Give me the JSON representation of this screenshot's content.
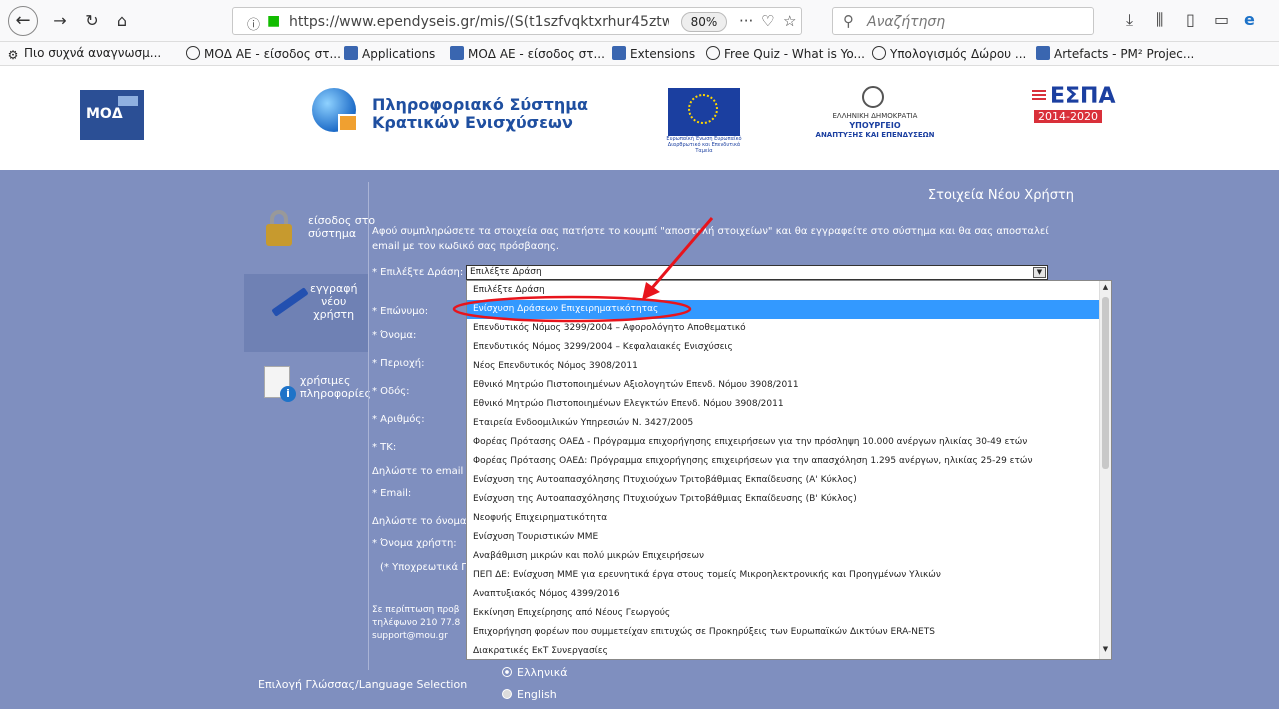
{
  "browser": {
    "url": "https://www.ependyseis.gr/mis/(S(t1szfvqktxrhur45ztw",
    "zoom": "80%",
    "search_placeholder": "Αναζήτηση"
  },
  "bookmarks": [
    "Πιο συχνά αναγνωσμ...",
    "ΜΟΔ ΑΕ - είσοδος στ...",
    "Applications",
    "ΜΟΔ ΑΕ - είσοδος στ...",
    "Extensions",
    "Free Quiz - What is Yo...",
    "Υπολογισμός Δώρου ...",
    "Artefacts - PM² Projec..."
  ],
  "banner": {
    "moda_logo": "ΜΟΔ",
    "pskt_line1": "Πληροφοριακό Σύστημα",
    "pskt_line2": "Κρατικών Ενισχύσεων",
    "eu_text": "Ευρωπαϊκή Ένωση Ευρωπαϊκό Διαρθρωτικό και Επενδυτικά Ταμεία",
    "gr_line1": "ΕΛΛΗΝΙΚΗ ΔΗΜΟΚΡΑΤΙΑ",
    "gr_line2": "ΥΠΟΥΡΓΕΙΟ",
    "gr_line3": "ΑΝΑΠΤΥΞΗΣ ΚΑΙ ΕΠΕΝΔΥΣΕΩΝ",
    "espa_title": "ΕΣΠΑ",
    "espa_years": "2014-2020"
  },
  "nav": {
    "login_line1": "είσοδος στο",
    "login_line2": "σύστημα",
    "register_line1": "εγγραφή",
    "register_line2": "νέου",
    "register_line3": "χρήστη",
    "info_line1": "χρήσιμες",
    "info_line2": "πληροφορίες"
  },
  "form": {
    "title": "Στοιχεία Νέου Χρήστη",
    "instructions": "Αφού συμπληρώσετε τα στοιχεία σας πατήστε το κουμπί \"αποστολή στοιχείων\" και θα εγγραφείτε στο σύστημα και θα σας αποσταλεί email με τον κωδικό σας πρόσβασης.",
    "action_label": "* Επιλέξτε Δράση:",
    "action_value": "Επιλέξτε Δράση",
    "labels": [
      "* Επώνυμο:",
      "* Όνομα:",
      "* Περιοχή:",
      "* Οδός:",
      "* Αριθμός:",
      "* ΤΚ:",
      "Δηλώστε το email σ",
      "* Email:",
      "Δηλώστε το όνομα χ",
      "* Όνομα χρήστη:",
      "(* Υποχρεωτικά Πε"
    ],
    "support_line1": "Σε περίπτωση προβ",
    "support_line2": "τηλέφωνο 210 77.8",
    "support_line3": "support@mou.gr"
  },
  "dropdown_options": [
    "Επιλέξτε Δράση",
    "Ενίσχυση Δράσεων Επιχειρηματικότητας",
    "Επενδυτικός Νόμος 3299/2004 – Αφορολόγητο Αποθεματικό",
    "Επενδυτικός Νόμος 3299/2004 – Κεφαλαιακές Ενισχύσεις",
    "Νέος Επενδυτικός Νόμος 3908/2011",
    "Εθνικό Μητρώο Πιστοποιημένων Αξιολογητών Επενδ. Νόμου 3908/2011",
    "Εθνικό Μητρώο Πιστοποιημένων Ελεγκτών Επενδ. Νόμου 3908/2011",
    "Εταιρεία Ενδοομιλικών Υπηρεσιών Ν. 3427/2005",
    "Φορέας Πρότασης ΟΑΕΔ - Πρόγραμμα επιχορήγησης επιχειρήσεων για την πρόσληψη 10.000 ανέργων ηλικίας 30-49 ετών",
    "Φορέας Πρότασης ΟΑΕΔ: Πρόγραμμα επιχορήγησης επιχειρήσεων για την απασχόληση 1.295 ανέργων, ηλικίας 25-29 ετών",
    "Ενίσχυση της Αυτοαπασχόλησης Πτυχιούχων Τριτοβάθμιας Εκπαίδευσης (Α' Κύκλος)",
    "Ενίσχυση της Αυτοαπασχόλησης Πτυχιούχων Τριτοβάθμιας Εκπαίδευσης (Β' Κύκλος)",
    "Νεοφυής Επιχειρηματικότητα",
    "Ενίσχυση Τουριστικών ΜΜΕ",
    "Αναβάθμιση μικρών και πολύ μικρών Επιχειρήσεων",
    "ΠΕΠ ΔΕ: Ενίσχυση ΜΜΕ για ερευνητικά έργα στους τομείς Μικροηλεκτρονικής και Προηγμένων Υλικών",
    "Αναπτυξιακός Νόμος 4399/2016",
    "Εκκίνηση Επιχείρησης από Νέους Γεωργούς",
    "Επιχορήγηση φορέων που συμμετείχαν επιτυχώς σε Προκηρύξεις των Ευρωπαϊκών Δικτύων ERA-NETS",
    "Διακρατικές ΕκΤ Συνεργασίες"
  ],
  "language": {
    "label": "Επιλογή Γλώσσας/Language Selection",
    "greek": "Ελληνικά",
    "english": "English"
  },
  "colors": {
    "panel": "#7f8fbf",
    "selected_option": "#3399ff",
    "annotation": "#e8141c"
  }
}
